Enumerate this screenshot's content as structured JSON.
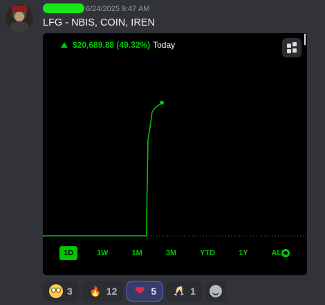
{
  "message": {
    "timestamp": "6/24/2025 9:47 AM",
    "text": "LFG - NBIS, COIN, IREN"
  },
  "embed": {
    "price_change": "$20,689.88 (49.32%)",
    "period": "Today",
    "accent_color": "#00c805",
    "ranges": [
      "1D",
      "1W",
      "1M",
      "3M",
      "YTD",
      "1Y",
      "ALL"
    ],
    "active_range": "1D"
  },
  "chart_data": {
    "type": "line",
    "title": "",
    "xlabel": "",
    "ylabel": "",
    "grid": false,
    "baseline_dotted": true,
    "series": [
      {
        "values": [
          0,
          0,
          0,
          0,
          0,
          0,
          0,
          0,
          0,
          0,
          0,
          0,
          0,
          0,
          0,
          0,
          0,
          0,
          0,
          0,
          0,
          0,
          0,
          0,
          0,
          0,
          0,
          0,
          0,
          0,
          0,
          0,
          0,
          0,
          0,
          0,
          0,
          0,
          0,
          0,
          0,
          0,
          0,
          0,
          0,
          0,
          0,
          0,
          0,
          0,
          0,
          0,
          0,
          0,
          0,
          0,
          0,
          0,
          0,
          0,
          0,
          0,
          0,
          0,
          0,
          0,
          0,
          0,
          0,
          0,
          0,
          0,
          0,
          0,
          0,
          0,
          0,
          0,
          0,
          0,
          0,
          0,
          0,
          0,
          0,
          0,
          0,
          0,
          0,
          0,
          0,
          0,
          0,
          0,
          0,
          0,
          0,
          0,
          0,
          0,
          0,
          0,
          0,
          0,
          0,
          0,
          0,
          0,
          0,
          0,
          0,
          0,
          0,
          0,
          0,
          0,
          0,
          0,
          0,
          0,
          0,
          0,
          0,
          0,
          0,
          0,
          0,
          0,
          0,
          0,
          0,
          0,
          0,
          0,
          0,
          0,
          0,
          0,
          0,
          0,
          4.6,
          35.5,
          40.3,
          45.9,
          47.7,
          48.3,
          49.3
        ]
      }
    ],
    "ylim": [
      0,
      52
    ]
  },
  "reactions": [
    {
      "icon": "flushed-face-icon",
      "count": "3"
    },
    {
      "icon": "fire-icon",
      "emoji": "🔥",
      "count": "12"
    },
    {
      "icon": "red-heart-icon",
      "emoji": "❤",
      "count": "5"
    },
    {
      "icon": "clinking-glasses-icon",
      "emoji": "🥂",
      "count": "1"
    }
  ]
}
